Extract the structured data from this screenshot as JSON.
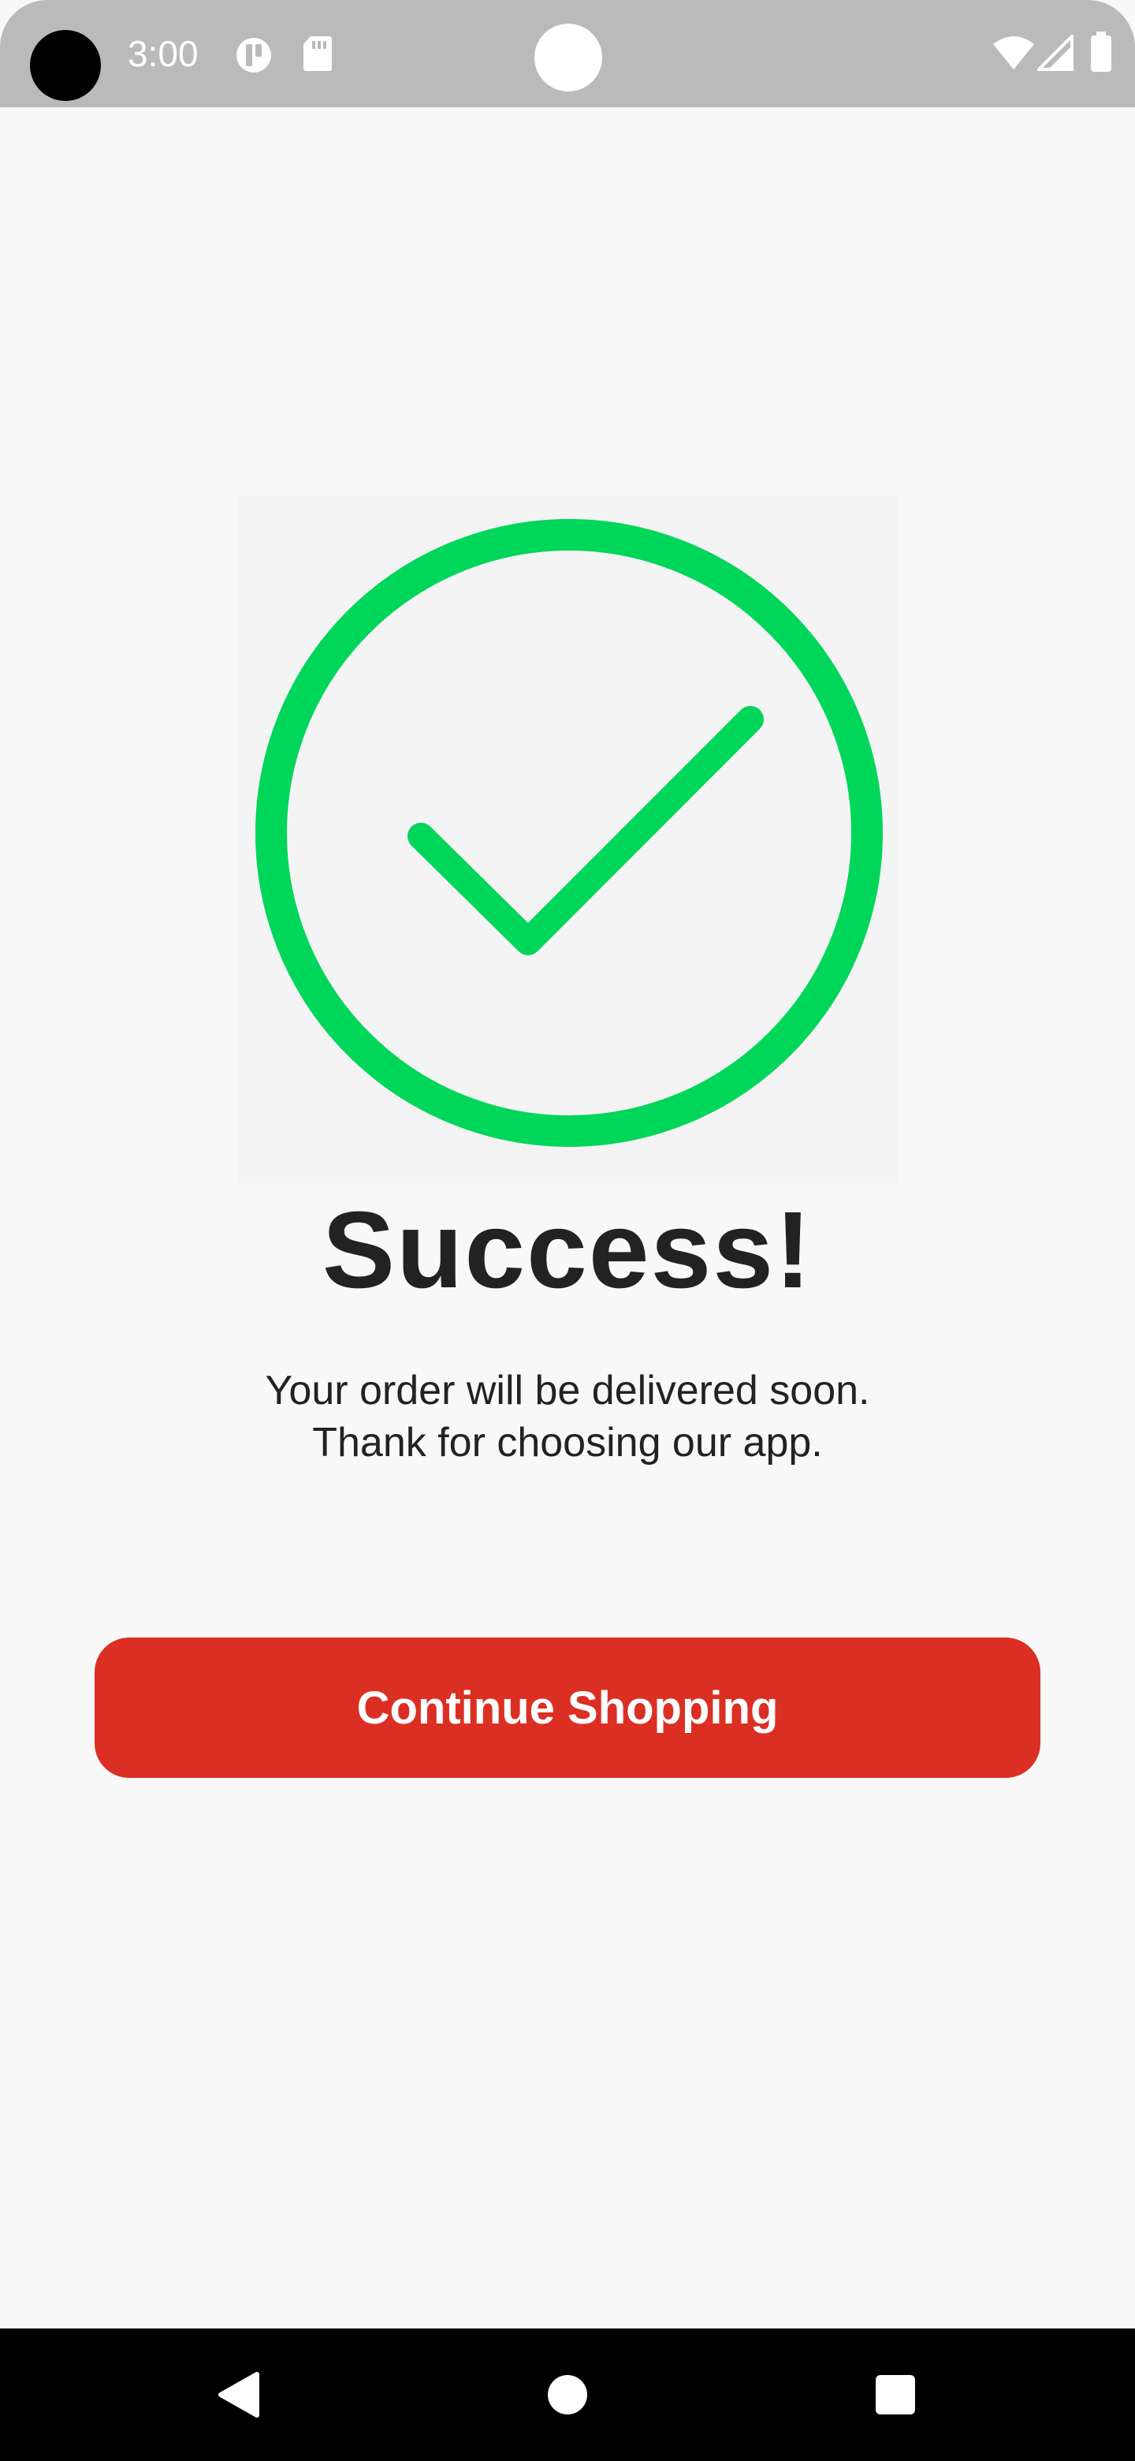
{
  "status_bar": {
    "time": "3:00",
    "icons": [
      "camera-cutout-icon",
      "t-app-icon",
      "sd-card-icon",
      "wifi-icon",
      "signal-icon",
      "battery-icon"
    ]
  },
  "hero": {
    "icon": "success-check-icon",
    "accent_color": "#00d65a"
  },
  "content": {
    "title": "Success!",
    "message_line1": "Your order will be delivered soon.",
    "message_line2": "Thank for choosing our app."
  },
  "actions": {
    "continue_label": "Continue Shopping",
    "button_color": "#dc2f23"
  },
  "navigation": {
    "items": [
      "back-icon",
      "home-icon",
      "recents-icon"
    ]
  }
}
